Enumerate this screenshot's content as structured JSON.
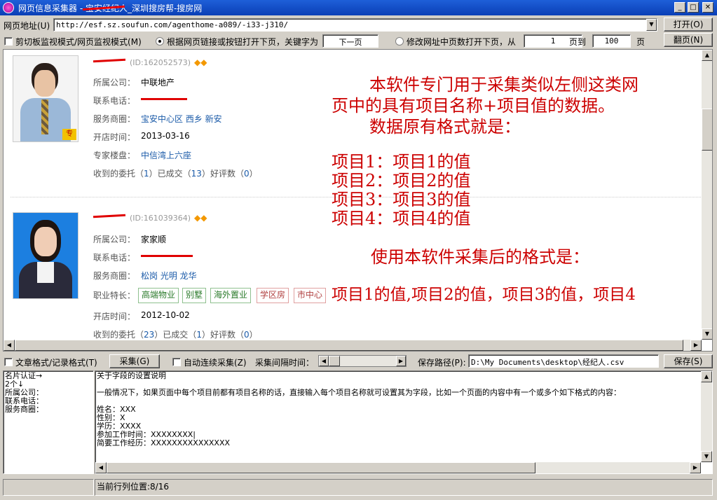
{
  "window": {
    "title": "网页信息采集器 - 宝安经纪人_深圳搜房帮-搜房网",
    "min": "_",
    "max": "□",
    "close": "✕"
  },
  "address": {
    "label": "网页地址(U)",
    "url": "http://esf.sz.soufun.com/agenthome-a089/-i33-j310/",
    "open_btn": "打开(O)",
    "page_btn": "翻页(N)"
  },
  "mode_row": {
    "clipboard_label": "剪切板监视模式/网页监视模式(M)",
    "link_mode_label": "根据网页链接或按钮打开下页，关键字为",
    "keyword_value": "下一页",
    "url_mode_label": "修改网址中页数打开下页，从",
    "from_value": "1",
    "to_label": "页到",
    "to_value": "100",
    "page_unit": "页"
  },
  "agents": [
    {
      "id_text": "(ID:162052573)",
      "company_label": "所属公司：",
      "company": "中联地产",
      "phone_label": "联系电话：",
      "area_label": "服务商圈：",
      "areas": "宝安中心区  西乡  新安",
      "open_label": "开店时间：",
      "open_date": "2013-03-16",
      "expert_label": "专家楼盘：",
      "expert": "中信湾上六座",
      "stats": [
        "收到的委托（",
        "1",
        "）已成交（",
        "13",
        "）好评数（",
        "0",
        "）"
      ],
      "badge": "专"
    },
    {
      "id_text": "(ID:161039364)",
      "company_label": "所属公司：",
      "company": "家家顺",
      "phone_label": "联系电话：",
      "area_label": "服务商圈：",
      "areas": "松岗  光明  龙华",
      "skill_label": "职业特长：",
      "skills": [
        "高端物业",
        "别墅",
        "海外置业",
        "学区房",
        "市中心"
      ],
      "open_label": "开店时间：",
      "open_date": "2012-10-02",
      "stats": [
        "收到的委托（",
        "23",
        "）已成交（",
        "1",
        "）好评数（",
        "0",
        "）"
      ]
    }
  ],
  "annotation": {
    "line1": "本软件专门用于采集类似左侧这类网",
    "line2": "页中的具有项目名称+项目值的数据。",
    "line3": "数据原有格式就是：",
    "items": [
      "项目1：项目1的值",
      "项目2：项目2的值",
      "项目3：项目3的值",
      "项目4：项目4的值"
    ],
    "after": "使用本软件采集后的格式是：",
    "result": "项目1的值,项目2的值，项目3的值，项目4"
  },
  "collect_row": {
    "article_label": "文章格式/记录格式(T)",
    "collect_btn": "采集(G)",
    "auto_label": "自动连续采集(Z)",
    "interval_label": "采集间隔时间：",
    "save_path_label": "保存路径(P):",
    "save_path": "D:\\My Documents\\desktop\\经纪人.csv",
    "save_btn": "保存(S)"
  },
  "fields_list": [
    "名片认证→",
    "2个↓",
    "所属公司：",
    "联系电话：",
    "服务商圈："
  ],
  "help": {
    "title": "关于字段的设置说明",
    "intro": "一般情况下，如果页面中每个项目前都有项目名称的话，直接输入每个项目名称就可设置其为字段，比如一个页面的内容中有一个或多个如下格式的内容：",
    "examples": [
      "姓名：XXX",
      "性别：X",
      "学历：XXXX",
      "参加工作时间：XXXXXXXX|",
      "简要工作经历：XXXXXXXXXXXXXXX"
    ]
  },
  "status": {
    "cursor": "当前行列位置:8/16"
  }
}
